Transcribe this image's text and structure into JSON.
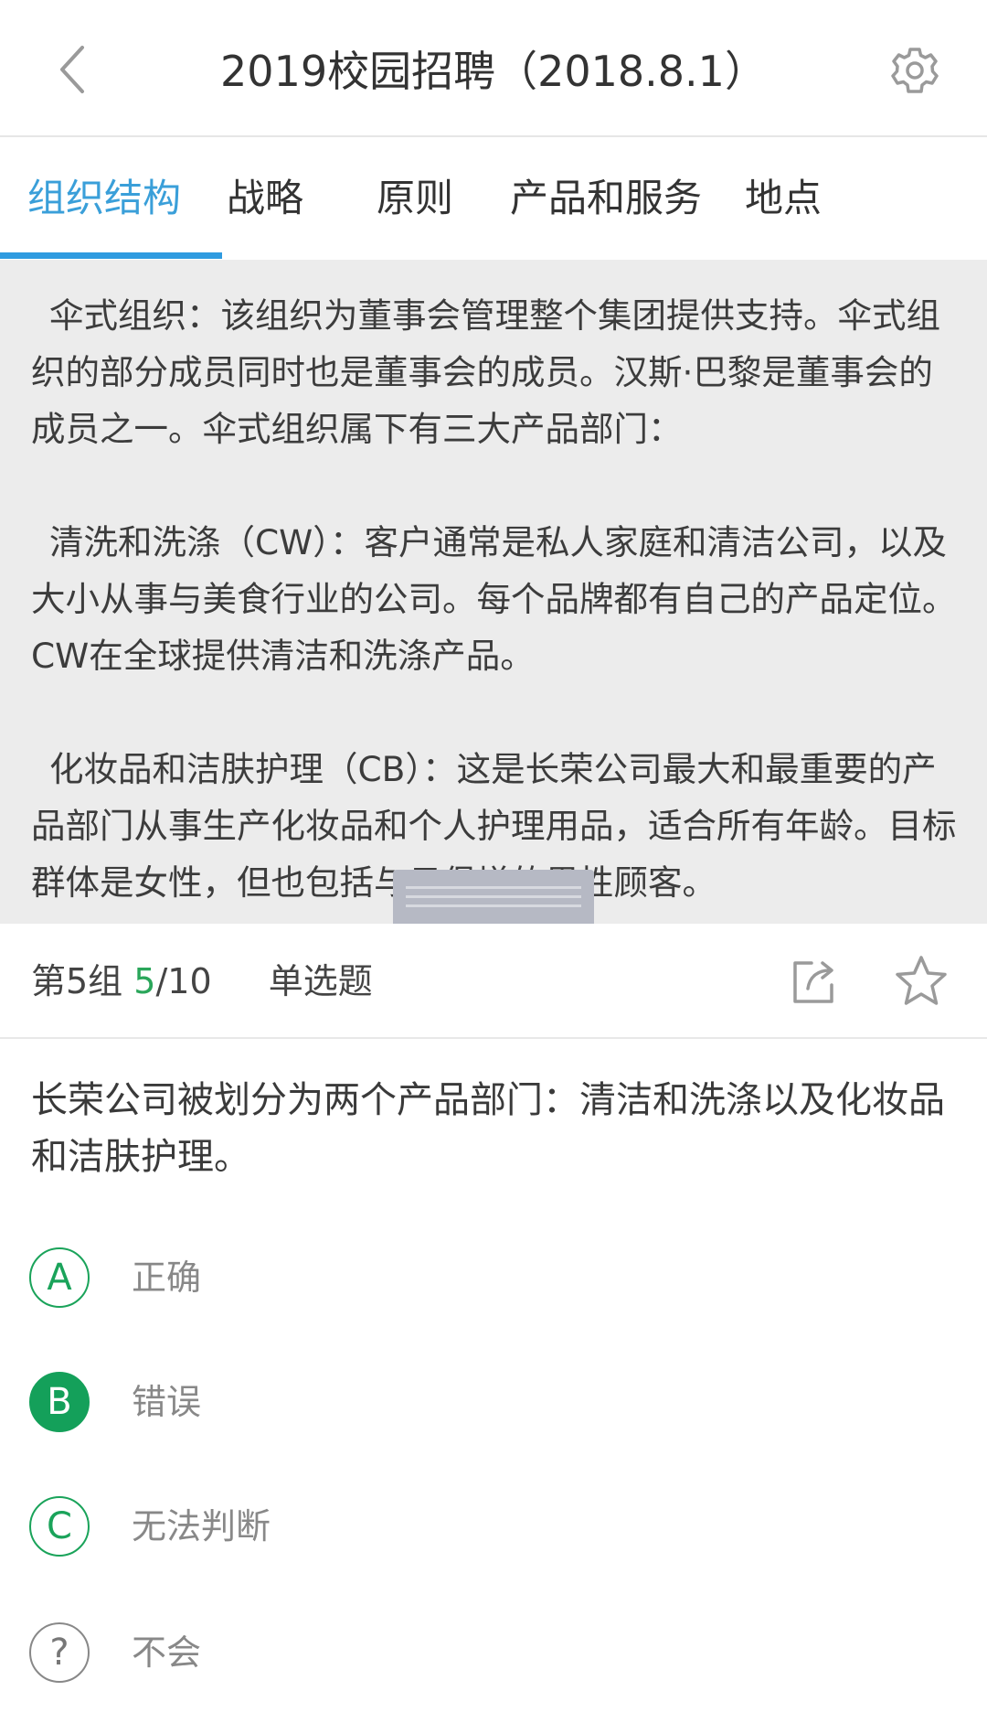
{
  "header": {
    "title": "2019校园招聘（2018.8.1）",
    "back_icon": "chevron-left-icon",
    "settings_icon": "gear-icon"
  },
  "tabs": [
    {
      "label": "组织结构",
      "active": true
    },
    {
      "label": "战略",
      "active": false
    },
    {
      "label": "原则",
      "active": false
    },
    {
      "label": "产品和服务",
      "active": false
    },
    {
      "label": "地点",
      "active": false
    }
  ],
  "passage": {
    "paragraphs": [
      "伞式组织：该组织为董事会管理整个集团提供支持。伞式组织的部分成员同时也是董事会的成员。汉斯·巴黎是董事会的成员之一。伞式组织属下有三大产品部门：",
      "清洗和洗涤（CW）：客户通常是私人家庭和清洁公司，以及大小从事与美食行业的公司。每个品牌都有自己的产品定位。CW在全球提供清洁和洗涤产品。",
      "化妆品和洁肤护理（CB）：这是长荣公司最大和最重要的产品部门从事生产化妆品和个人护理用品，适合所有年龄。目标群体是女性，但也包括与日俱增的男性顾客。"
    ]
  },
  "question_bar": {
    "group": "第5组",
    "current": "5",
    "total": "/10",
    "type": "单选题",
    "share_icon": "share-icon",
    "favorite_icon": "star-icon"
  },
  "question": {
    "text": "长荣公司被划分为两个产品部门：清洁和洗涤以及化妆品和洁肤护理。"
  },
  "options": [
    {
      "key": "A",
      "text": "正确",
      "selected": false
    },
    {
      "key": "B",
      "text": "错误",
      "selected": true
    },
    {
      "key": "C",
      "text": "无法判断",
      "selected": false
    },
    {
      "key": "?",
      "text": "不会",
      "selected": false
    }
  ],
  "colors": {
    "accent_blue": "#2f9be0",
    "accent_green": "#14a05a",
    "passage_bg": "#ececec"
  }
}
